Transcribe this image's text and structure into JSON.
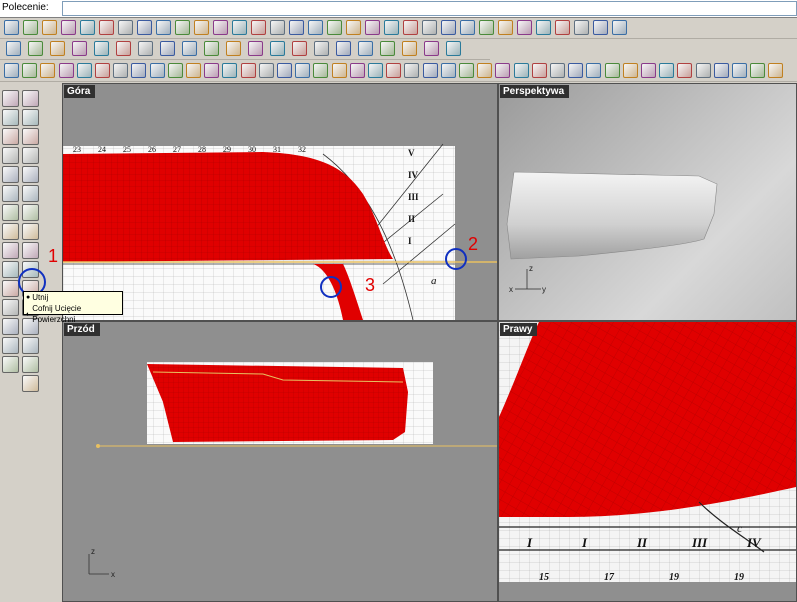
{
  "command": {
    "label": "Polecenie:",
    "value": ""
  },
  "viewports": {
    "top": {
      "label": "Góra"
    },
    "perspective": {
      "label": "Perspektywa"
    },
    "front": {
      "label": "Przód"
    },
    "right": {
      "label": "Prawy"
    }
  },
  "tooltip": {
    "line1": "Utnij",
    "line2": "Cofnij Ucięcie Powierzchni"
  },
  "annotations": {
    "n1": "1",
    "n2": "2",
    "n3": "3"
  },
  "blueprint": {
    "frame_numbers": [
      "23",
      "24",
      "25",
      "26",
      "27",
      "28",
      "29",
      "30",
      "31",
      "32"
    ],
    "roman_top": [
      "V",
      "IV",
      "III",
      "II",
      "I"
    ],
    "bottom_letter": "a",
    "right_letter": "c",
    "roman_bottom": [
      "I",
      "I",
      "II",
      "III",
      "IV"
    ],
    "bottom_numbers": [
      "15",
      "17",
      "19",
      "19"
    ]
  },
  "axes": {
    "x": "x",
    "y": "y",
    "z": "z"
  },
  "colors": {
    "hull": "#e00000",
    "viewport_bg": "#8f8f8f",
    "accent_blue": "#1030c0",
    "guide_line": "#e8c060"
  },
  "icons": {
    "row1": [
      "new-file-icon",
      "open-folder-icon",
      "save-icon",
      "print-icon",
      "copy-window-icon",
      "cut-icon",
      "copy-icon",
      "paste-icon",
      "undo-icon",
      "pan-icon",
      "rotate-view-icon",
      "zoom-window-icon",
      "zoom-dynamic-icon",
      "zoom-extents-icon",
      "zoom-selected-icon",
      "view-layout-icon",
      "car-icon",
      "curve-icon",
      "gear-icon",
      "lightbulb-icon",
      "lock-icon",
      "color-icon",
      "shade-icon",
      "wireframe-icon",
      "render-icon",
      "sphere-icon",
      "points-icon",
      "options-icon",
      "grid-icon",
      "help-icon",
      "layer-icon",
      "plugin-icon",
      "user-icon"
    ],
    "row2": [
      "point-icon",
      "curve-tools-icon",
      "surface-icon",
      "solid-icon",
      "mesh-icon",
      "dimension-icon",
      "transform-icon",
      "array-icon",
      "snap-icon",
      "osnap-icon",
      "analyze-icon",
      "render-tools-icon",
      "drafting-icon",
      "edit-icon",
      "history-icon",
      "filter-icon",
      "select-icon",
      "block-icon",
      "group-icon",
      "text-icon",
      "hatch-icon"
    ],
    "row3": [
      "surface-from-curves-icon",
      "loft-icon",
      "sweep-icon",
      "revolve-icon",
      "extrude-icon",
      "patch-icon",
      "network-icon",
      "blend-icon",
      "fillet-icon",
      "offset-icon",
      "trim-icon",
      "split-icon",
      "join-icon",
      "explode-icon",
      "rebuild-icon",
      "match-icon",
      "merge-icon",
      "untrim-icon",
      "shrink-icon",
      "plane-icon",
      "corner-icon",
      "edge-icon",
      "unroll-icon",
      "flow-icon",
      "morph-icon",
      "cage-icon",
      "twist-icon",
      "bend-icon",
      "taper-icon",
      "analysis-icon",
      "curvature-icon",
      "zebra-icon",
      "draft-icon",
      "environment-icon",
      "emap-icon",
      "points-on-icon",
      "points-off-icon",
      "control-icon",
      "mirror-icon",
      "orient-icon",
      "scale-icon",
      "rotate-icon",
      "move-icon"
    ],
    "left_col1": [
      "tool-arc-icon",
      "tool-ellipse-icon",
      "tool-curve-icon",
      "tool-box-icon",
      "tool-point-icon",
      "tool-cone-icon",
      "tool-circle-icon",
      "tool-pipe-icon",
      "tool-line-icon",
      "tool-trim-icon",
      "tool-extend-icon",
      "tool-fillet-icon",
      "tool-curve2-icon",
      "tool-array-icon",
      "tool-polygon-icon"
    ],
    "left_col2": [
      "select-arrow-icon",
      "polyline-icon",
      "circle-tool-icon",
      "rectangle-icon",
      "polygon-tool-icon",
      "ellipse-tool-icon",
      "arc-tool-icon",
      "curve-tool-icon",
      "box-tool-icon",
      "sphere-tool-icon",
      "cylinder-tool-icon",
      "trim-tool-icon",
      "split-tool-icon",
      "text-tool-icon",
      "group-tool-icon",
      "mesh-tool-icon"
    ]
  }
}
